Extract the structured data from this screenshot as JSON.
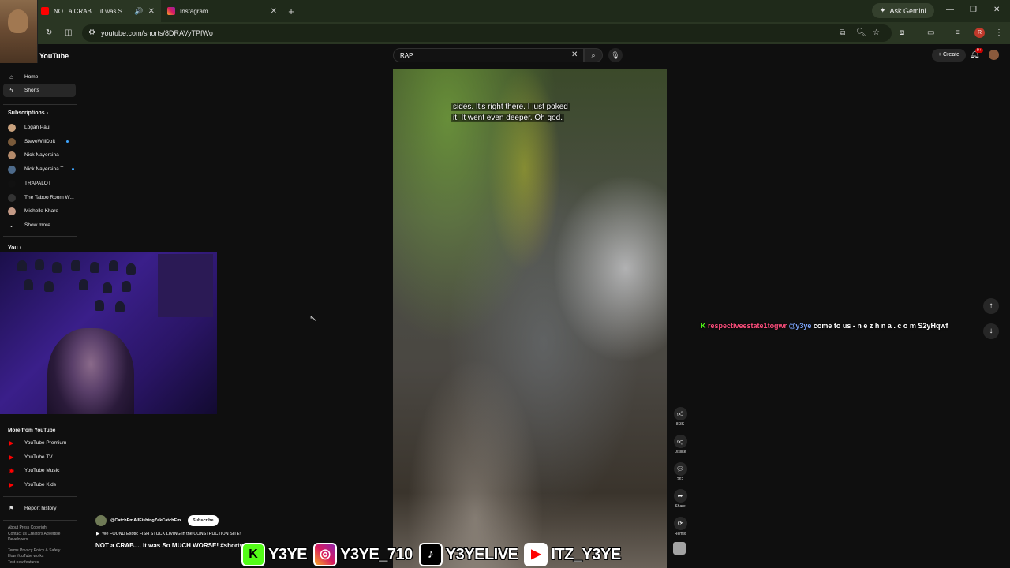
{
  "browser": {
    "tabs": [
      {
        "title": "NOT a CRAB.... it was S",
        "active": true
      },
      {
        "title": "Instagram",
        "active": false
      }
    ],
    "ask_gemini": "Ask Gemini",
    "url": "youtube.com/shorts/8DRAVyTPfWo",
    "profile_initial": "R"
  },
  "youtube": {
    "logo": "YouTube",
    "search_value": "RAP",
    "create_label": "Create",
    "notif_badge": "9+"
  },
  "sidebar": {
    "main": [
      {
        "label": "Home",
        "icon": "home-icon"
      },
      {
        "label": "Shorts",
        "icon": "shorts-icon",
        "active": true
      }
    ],
    "subscriptions_header": "Subscriptions",
    "subscriptions": [
      {
        "label": "Logan Paul",
        "color": "#c9a27e",
        "live": false
      },
      {
        "label": "SteveWillDoIt",
        "color": "#7a5a3a",
        "live": true
      },
      {
        "label": "Nick Nayersina",
        "color": "#b48a6a",
        "live": false
      },
      {
        "label": "Nick Nayersina T...",
        "color": "#4d6a8a",
        "live": true
      },
      {
        "label": "TRAPALOT",
        "color": "#111111",
        "live": false
      },
      {
        "label": "The Taboo Room W...",
        "color": "#333333",
        "live": false
      },
      {
        "label": "Michelle Khare",
        "color": "#c49a86",
        "live": false
      }
    ],
    "show_more": "Show more",
    "you_header": "You",
    "more_header": "More from YouTube",
    "more": [
      {
        "label": "YouTube Premium"
      },
      {
        "label": "YouTube TV"
      },
      {
        "label": "YouTube Music"
      },
      {
        "label": "YouTube Kids"
      }
    ],
    "report_history": "Report history",
    "footer1": "About  Press  Copyright",
    "footer2": "Contact us  Creators  Advertise",
    "footer3": "Developers",
    "footer4": "Terms  Privacy  Policy & Safety",
    "footer5": "How YouTube works",
    "footer6": "Test new features"
  },
  "video": {
    "caption_line1": "sides. It's right there. I just poked",
    "caption_line2": "it. It went even deeper. Oh god.",
    "channel": "@CatchEmAllFishingZakCatchEm",
    "subscribe": "Subscribe",
    "music": "We FOUND Exotic FISH STUCK LIVING in the CONSTRUCTION SITE!",
    "title": "NOT a CRAB.... it was So MUCH WORSE! #shorts"
  },
  "actions": {
    "likes": "8.3K",
    "dislike": "Dislike",
    "comments": "262",
    "share": "Share",
    "remix": "Remix"
  },
  "chat": {
    "user": "respectiveestate1togwr",
    "mention": "@y3ye",
    "message": "come to us - n e z h n a . c o m S2yHqwf"
  },
  "banner": {
    "kick": "Y3YE",
    "instagram": "Y3YE_710",
    "tiktok": "Y3YELIVE",
    "youtube": "ITZ_Y3YE"
  }
}
